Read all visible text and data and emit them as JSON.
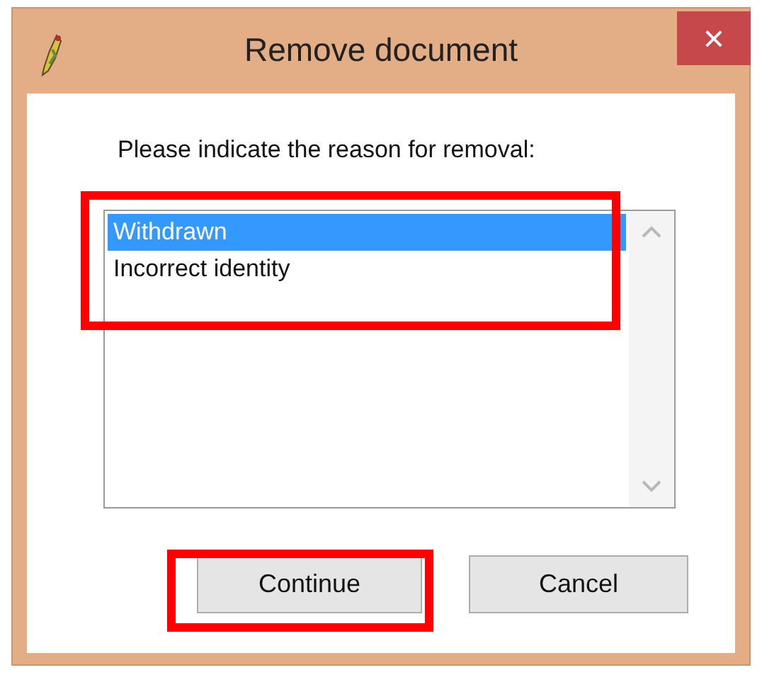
{
  "window": {
    "title": "Remove document",
    "close": "×"
  },
  "prompt": "Please indicate the reason for removal:",
  "reasons": {
    "highlighted": true,
    "items": [
      {
        "label": "Withdrawn",
        "selected": true
      },
      {
        "label": "Incorrect identity",
        "selected": false
      }
    ]
  },
  "buttons": [
    {
      "label": "Continue",
      "highlighted": true
    },
    {
      "label": "Cancel",
      "highlighted": false
    }
  ]
}
